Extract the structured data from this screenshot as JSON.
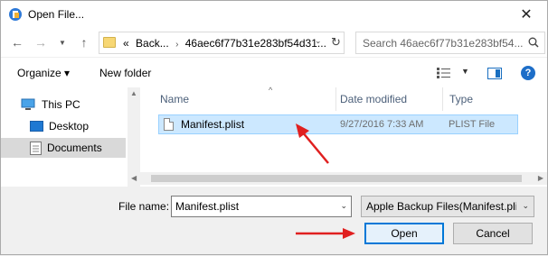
{
  "window": {
    "title": "Open File..."
  },
  "address": {
    "prefix": "«",
    "crumbs": [
      "Back...",
      "46aec6f77b31e283bf54d31..."
    ],
    "separator": "›"
  },
  "search": {
    "placeholder": "Search 46aec6f77b31e283bf54..."
  },
  "toolbar": {
    "organize_label": "Organize ▾",
    "new_folder_label": "New folder"
  },
  "sidebar": {
    "items": [
      {
        "label": "This PC",
        "icon": "computer-icon"
      },
      {
        "label": "Desktop",
        "icon": "desktop-icon"
      },
      {
        "label": "Documents",
        "icon": "documents-icon",
        "selected": true
      }
    ]
  },
  "file_list": {
    "columns": [
      "Name",
      "Date modified",
      "Type"
    ],
    "rows": [
      {
        "name": "Manifest.plist",
        "date": "9/27/2016 7:33 AM",
        "type": "PLIST File",
        "selected": true
      }
    ]
  },
  "footer": {
    "file_name_label": "File name:",
    "file_name_value": "Manifest.plist",
    "filter_value": "Apple Backup Files(Manifest.pli",
    "open_label": "Open",
    "cancel_label": "Cancel"
  },
  "colors": {
    "selection": "#cce8ff",
    "primary_border": "#0078d7",
    "annotation_arrow": "#e02020"
  }
}
